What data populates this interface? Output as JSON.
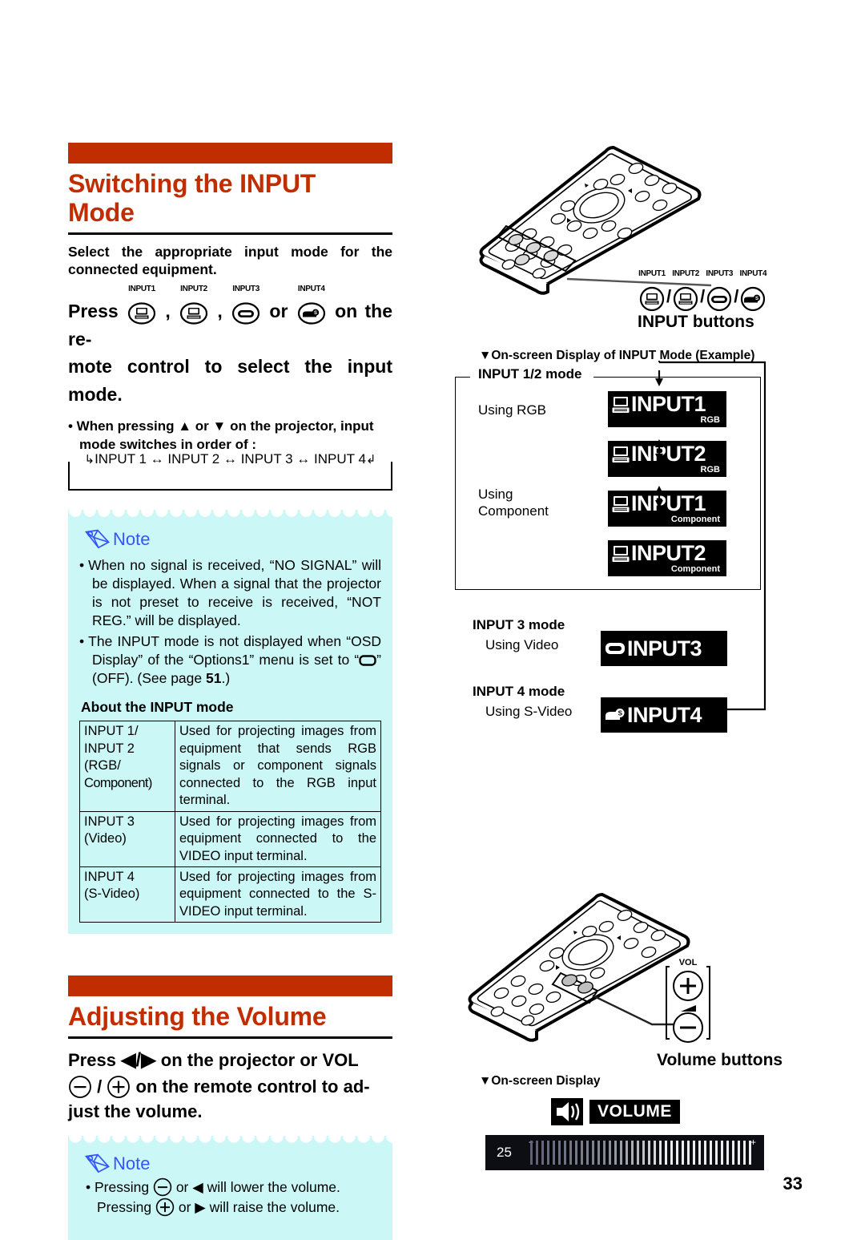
{
  "page_number": "33",
  "colors": {
    "accent": "#c22d00",
    "note_bg": "#ccf7f7",
    "note_label": "#3355ff"
  },
  "section1": {
    "title_line1": "Switching the INPUT",
    "title_line2": "Mode",
    "lead": "Select the appropriate input mode for the connected equipment.",
    "press_prefix": "Press",
    "press_sep1": ",",
    "press_sep2": ",",
    "press_or": "or",
    "press_tail": "on the re-",
    "press_line2": "mote control to select the input mode.",
    "bullet_line1": "• When pressing ▲ or ▼ on the projector, input",
    "bullet_line2": "mode switches in order of :",
    "order_text": "INPUT 1 ↔ INPUT 2 ↔ INPUT 3 ↔ INPUT 4",
    "button_caps": [
      "INPUT1",
      "INPUT2",
      "INPUT3",
      "INPUT4"
    ],
    "note": {
      "label": "Note",
      "items": [
        "When no signal is received, “NO SIGNAL” will be displayed. When a signal that the projector is not preset to receive is received, “NOT REG.” will be displayed.",
        "The INPUT mode is not displayed when “OSD Display” of the “Options1” menu is set to “⬜” (OFF). (See page 51.)"
      ],
      "item2_parts": {
        "a": "The INPUT mode is not displayed when “OSD Display” of the “Options1” menu is set to “",
        "b": "” (OFF). (See page ",
        "page_ref": "51",
        "c": ".)"
      }
    },
    "about_heading": "About the INPUT mode",
    "table": {
      "rows": [
        {
          "mode": "INPUT 1/\nINPUT 2\n(RGB/\nComponent)",
          "desc": "Used for projecting images from equipment that sends RGB signals or component signals connected to the RGB input terminal."
        },
        {
          "mode": "INPUT 3\n(Video)",
          "desc": "Used for projecting images from equipment connected to the VIDEO input terminal."
        },
        {
          "mode": "INPUT 4\n(S-Video)",
          "desc": "Used for projecting images from equipment connected to the S-VIDEO input terminal."
        }
      ]
    }
  },
  "section2": {
    "title": "Adjusting the Volume",
    "press_line1_a": "Press",
    "press_line1_b": "◀/▶",
    "press_line1_c": "on the projector or VOL",
    "press_line2_a": "/",
    "press_line2_b": "on the remote control to ad-",
    "press_line3": "just the volume.",
    "note": {
      "label": "Note",
      "line1_a": "• Pressing",
      "line1_b": "or ◀ will lower the volume.",
      "line2_a": "Pressing",
      "line2_b": "or ▶ will raise the volume."
    }
  },
  "right": {
    "input_buttons_label": "INPUT buttons",
    "input_button_caps": [
      "INPUT1",
      "INPUT2",
      "INPUT3",
      "INPUT4"
    ],
    "osd_caption_input": "▼On-screen Display of INPUT Mode (Example)",
    "input12_mode_label": "INPUT 1/2 mode",
    "using_rgb": "Using RGB",
    "using_component_l1": "Using",
    "using_component_l2": "Component",
    "osd_items_12": [
      {
        "main": "INPUT1",
        "sub": "RGB",
        "icon": "computer-icon"
      },
      {
        "main": "INPUT2",
        "sub": "RGB",
        "icon": "computer-icon"
      },
      {
        "main": "INPUT1",
        "sub": "Component",
        "icon": "computer-icon"
      },
      {
        "main": "INPUT2",
        "sub": "Component",
        "icon": "computer-icon"
      }
    ],
    "input3_mode_label": "INPUT 3 mode",
    "using_video": "Using Video",
    "osd_input3": {
      "main": "INPUT3",
      "icon": "video-icon"
    },
    "input4_mode_label": "INPUT 4 mode",
    "using_svideo": "Using S-Video",
    "osd_input4": {
      "main": "INPUT4",
      "icon": "svideo-icon"
    },
    "vol_label": "VOL",
    "volume_buttons_label": "Volume buttons",
    "osd_caption_volume": "▼On-screen Display",
    "volume_tag": "VOLUME",
    "volume_value": "25",
    "volume_minus": "−",
    "volume_plus": "+"
  }
}
